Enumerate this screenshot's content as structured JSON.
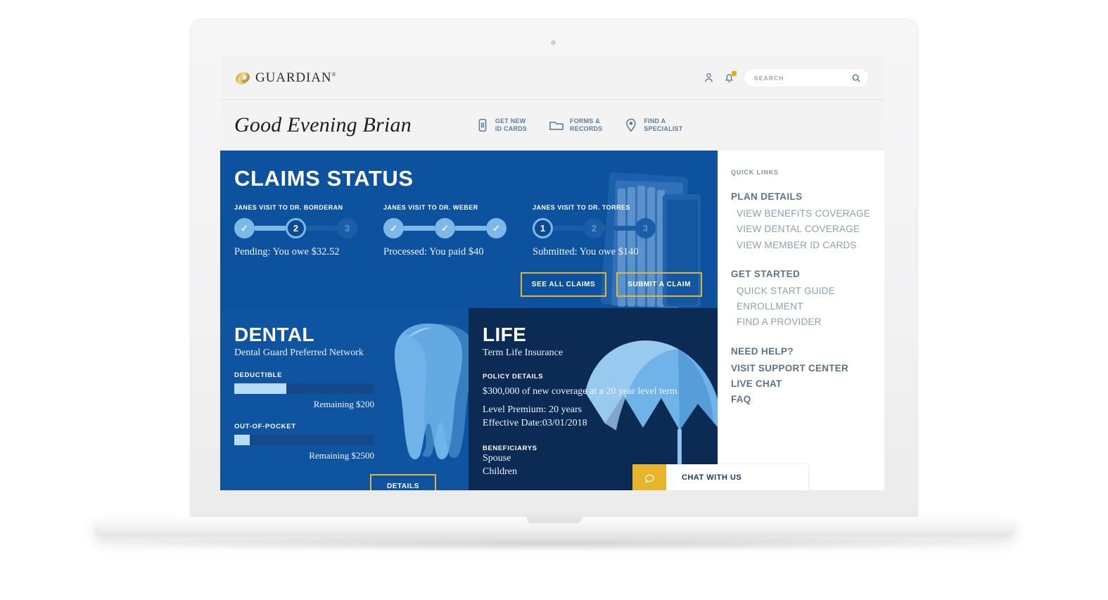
{
  "header": {
    "brand_name": "GUARDIAN",
    "brand_trademark": "®",
    "account_icon": "person-icon",
    "notifications_icon": "bell-icon",
    "search": {
      "placeholder": "SEARCH",
      "value": "",
      "icon": "search-icon"
    }
  },
  "greeting": {
    "text": "Good Evening Brian",
    "quick_actions": [
      {
        "label": "GET NEW\nID CARDS",
        "icon": "id-card-icon"
      },
      {
        "label": "FORMS &\nRECORDS",
        "icon": "folder-icon"
      },
      {
        "label": "FIND A\nSPECIALIST",
        "icon": "location-pin-icon"
      }
    ]
  },
  "claims": {
    "title": "CLAIMS STATUS",
    "items": [
      {
        "name": "JANES VISIT TO DR. BORDERAN",
        "status": "Pending: You owe $32.52",
        "steps": [
          {
            "label": "✓",
            "state": "done"
          },
          {
            "label": "2",
            "state": "current"
          },
          {
            "label": "3",
            "state": "todo"
          }
        ]
      },
      {
        "name": "JANES VISIT TO DR. WEBER",
        "status": "Processed: You paid $40",
        "steps": [
          {
            "label": "✓",
            "state": "done"
          },
          {
            "label": "✓",
            "state": "done"
          },
          {
            "label": "✓",
            "state": "done"
          }
        ]
      },
      {
        "name": "JANES VISIT TO DR. TORRES",
        "status": "Submitted: You owe $140",
        "steps": [
          {
            "label": "1",
            "state": "current"
          },
          {
            "label": "2",
            "state": "todo"
          },
          {
            "label": "3",
            "state": "todo"
          }
        ]
      }
    ],
    "see_all_label": "SEE ALL CLAIMS",
    "submit_label": "SUBMIT A CLAIM"
  },
  "dental": {
    "title": "DENTAL",
    "subtitle": "Dental Guard Preferred Network",
    "meters": [
      {
        "label": "DEDUCTIBLE",
        "remaining": "Remaining $200",
        "fill_percent": 37
      },
      {
        "label": "OUT-OF-POCKET",
        "remaining": "Remaining $2500",
        "fill_percent": 11
      }
    ],
    "details_label": "DETAILS",
    "artwork": "tooth-illustration"
  },
  "life": {
    "title": "LIFE",
    "subtitle": "Term Life Insurance",
    "policy_heading": "POLICY DETAILS",
    "policy_summary": "$300,000 of new coverage at a 20 year level term",
    "level_premium": "Level Premium: 20 years",
    "effective_date": "Effective Date:03/01/2018",
    "beneficiaries_heading": "BENEFICIARYS",
    "beneficiaries": [
      "Spouse",
      "Children"
    ],
    "artwork": "umbrella-illustration"
  },
  "sidebar": {
    "kicker": "QUICK LINKS",
    "groups": [
      {
        "heading": "PLAN DETAILS",
        "bold_links": false,
        "links": [
          "VIEW BENEFITS COVERAGE",
          "VIEW DENTAL COVERAGE",
          "VIEW MEMBER ID CARDS"
        ]
      },
      {
        "heading": "GET STARTED",
        "bold_links": false,
        "links": [
          "QUICK START GUIDE",
          "ENROLLMENT",
          "FIND A PROVIDER"
        ]
      },
      {
        "heading": "NEED HELP?",
        "bold_links": true,
        "links": [
          "VISIT SUPPORT CENTER",
          "LIVE CHAT",
          "FAQ"
        ]
      }
    ]
  },
  "chat": {
    "label": "CHAT WITH US",
    "icon": "speech-bubble-icon"
  },
  "colors": {
    "brand_gold": "#e2b33c",
    "claims_blue": "#0d529f",
    "dental_blue": "#0f54a0",
    "life_navy": "#0b2a54",
    "step_light": "#7db8e8",
    "chat_gold": "#e7b529",
    "sidebar_heading": "#5d7486",
    "sidebar_link": "#8ca0b0"
  }
}
